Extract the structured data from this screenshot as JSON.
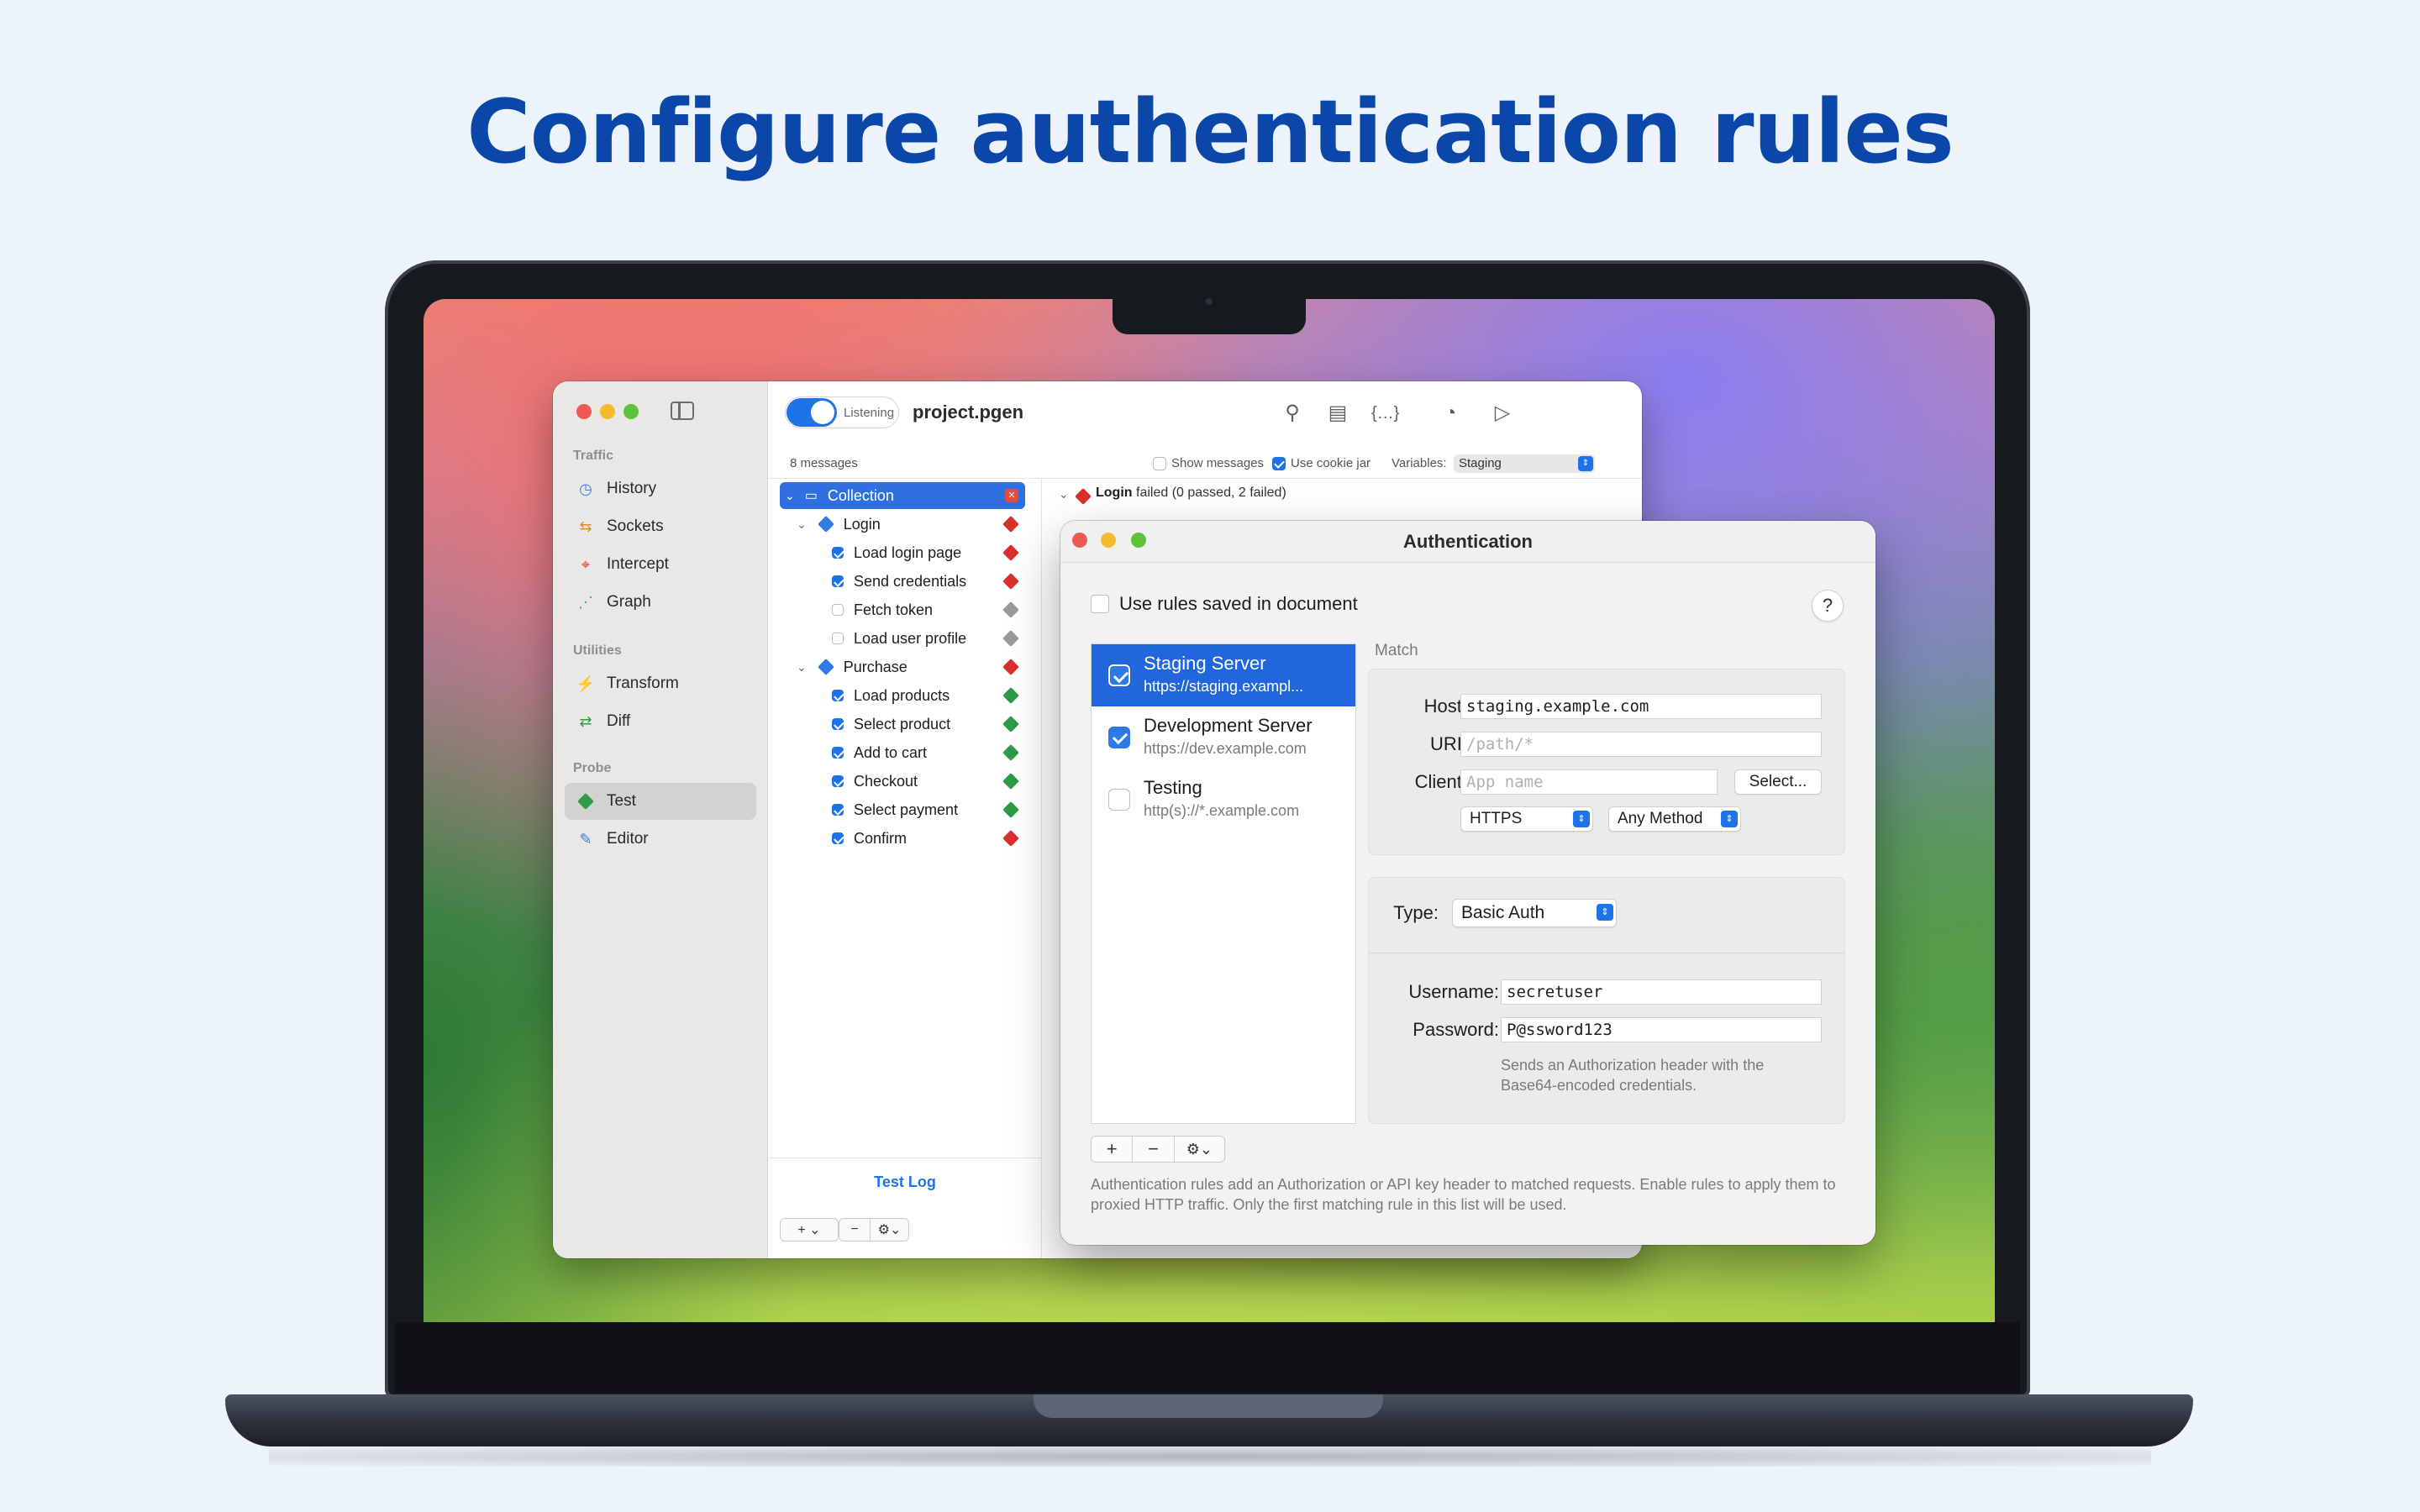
{
  "headline": "Configure authentication rules",
  "app": {
    "sidebar": {
      "sections": [
        {
          "title": "Traffic",
          "items": [
            {
              "label": "History"
            },
            {
              "label": "Sockets"
            },
            {
              "label": "Intercept"
            },
            {
              "label": "Graph"
            }
          ]
        },
        {
          "title": "Utilities",
          "items": [
            {
              "label": "Transform"
            },
            {
              "label": "Diff"
            }
          ]
        },
        {
          "title": "Probe",
          "items": [
            {
              "label": "Test",
              "active": true
            },
            {
              "label": "Editor"
            }
          ]
        }
      ]
    },
    "toolbar": {
      "listening_label": "Listening",
      "listening_on": true,
      "title": "project.pgen"
    },
    "subbar": {
      "message_count": "8 messages",
      "show_messages_label": "Show messages",
      "show_messages": false,
      "cookie_jar_label": "Use cookie jar",
      "cookie_jar": true,
      "variables_label": "Variables:",
      "variables_value": "Staging"
    },
    "tree": {
      "root": "Collection",
      "groups": [
        {
          "name": "Login",
          "children": [
            {
              "label": "Load login page",
              "checked": true,
              "status": "failed"
            },
            {
              "label": "Send credentials",
              "checked": true,
              "status": "failed"
            },
            {
              "label": "Fetch token",
              "checked": false,
              "status": "skipped"
            },
            {
              "label": "Load user profile",
              "checked": false,
              "status": "skipped"
            }
          ]
        },
        {
          "name": "Purchase",
          "children": [
            {
              "label": "Load products",
              "checked": true,
              "status": "passed"
            },
            {
              "label": "Select product",
              "checked": true,
              "status": "passed"
            },
            {
              "label": "Add to cart",
              "checked": true,
              "status": "passed"
            },
            {
              "label": "Checkout",
              "checked": true,
              "status": "passed"
            },
            {
              "label": "Select payment",
              "checked": true,
              "status": "passed"
            },
            {
              "label": "Confirm",
              "checked": true,
              "status": "failed"
            }
          ]
        }
      ],
      "footer": "Test Log"
    },
    "log": {
      "entry_name": "Login",
      "entry_detail": "failed (0 passed, 2 failed)"
    }
  },
  "dialog": {
    "title": "Authentication",
    "use_saved_label": "Use rules saved in document",
    "use_saved": false,
    "help": "?",
    "rules": [
      {
        "name": "Staging Server",
        "url": "https://staging.exampl...",
        "enabled": true,
        "selected": true
      },
      {
        "name": "Development Server",
        "url": "https://dev.example.com",
        "enabled": true,
        "selected": false
      },
      {
        "name": "Testing",
        "url": "http(s)://*.example.com",
        "enabled": false,
        "selected": false
      }
    ],
    "match": {
      "section_label": "Match",
      "host_label": "Host:",
      "host_value": "staging.example.com",
      "uri_label": "URI:",
      "uri_placeholder": "/path/*",
      "client_label": "Client:",
      "client_placeholder": "App name",
      "select_button": "Select...",
      "protocol": "HTTPS",
      "method": "Any Method"
    },
    "auth": {
      "type_label": "Type:",
      "type_value": "Basic Auth",
      "username_label": "Username:",
      "username_value": "secretuser",
      "password_label": "Password:",
      "password_value": "P@ssword123",
      "hint": "Sends an Authorization header with the Base64-encoded credentials."
    },
    "footer_text": "Authentication rules add an Authorization or API key header to matched requests. Enable rules to apply them to proxied HTTP traffic. Only the first matching rule in this list will be used."
  },
  "colors": {
    "accent": "#1e73e8",
    "headline": "#0a47a8",
    "failed": "#d9302c",
    "passed": "#2e9b47",
    "skipped": "#9a9a9a"
  }
}
